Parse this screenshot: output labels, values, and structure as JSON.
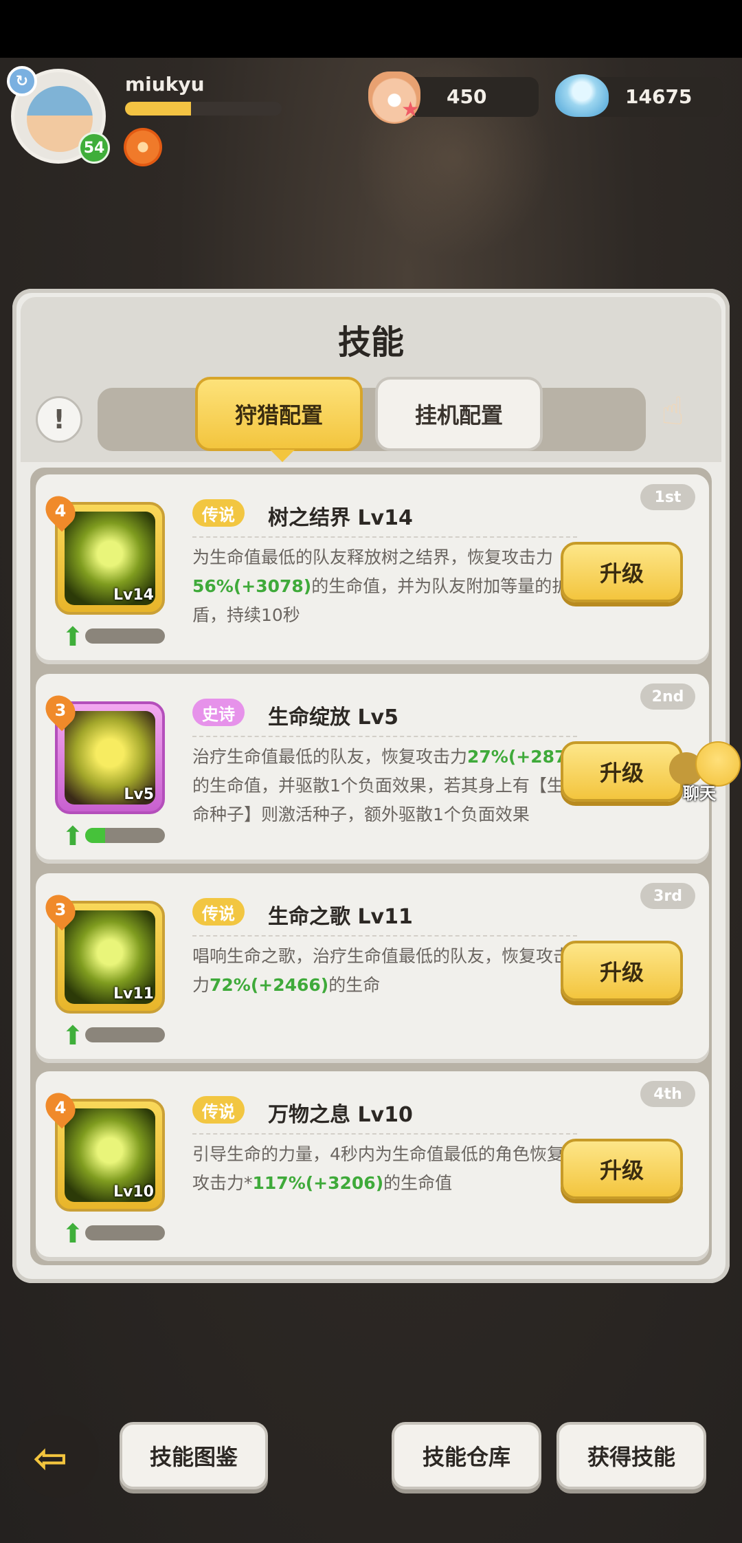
{
  "player": {
    "username": "miukyu",
    "level": "54",
    "xp_fraction": 0.42
  },
  "currencies": [
    {
      "icon": "pearl-shell-icon",
      "value": "450"
    },
    {
      "icon": "blue-shell-icon",
      "value": "14675"
    }
  ],
  "panel": {
    "title": "技能",
    "tabs": [
      {
        "label": "狩猎配置",
        "active": true
      },
      {
        "label": "挂机配置",
        "active": false
      }
    ],
    "info_button": "!"
  },
  "skills": [
    {
      "rank": "1st",
      "stars": "4",
      "rarity": "传说",
      "name": "树之结界 Lv14",
      "icon_level": "Lv14",
      "desc_parts": [
        "为生命值最低的队友释放树之结界，恢复攻击力",
        "56%(+3078)",
        "的生命值，并为队友附加等量的护盾，持续10秒"
      ],
      "progress": 0.0,
      "button": "升级"
    },
    {
      "rank": "2nd",
      "stars": "3",
      "rarity": "史诗",
      "name": "生命绽放 Lv5",
      "icon_level": "Lv5",
      "desc_parts": [
        "治疗生命值最低的队友，恢复攻击力",
        "27%(+287)",
        "的生命值，并驱散1个负面效果，若其身上有【生命种子】则激活种子，额外驱散1个负面效果"
      ],
      "progress": 0.25,
      "button": "升级"
    },
    {
      "rank": "3rd",
      "stars": "3",
      "rarity": "传说",
      "name": "生命之歌 Lv11",
      "icon_level": "Lv11",
      "desc_parts": [
        "唱响生命之歌，治疗生命值最低的队友，恢复攻击力",
        "72%(+2466)",
        "的生命"
      ],
      "progress": 0.0,
      "button": "升级"
    },
    {
      "rank": "4th",
      "stars": "4",
      "rarity": "传说",
      "name": "万物之息 Lv10",
      "icon_level": "Lv10",
      "desc_parts": [
        "引导生命的力量，4秒内为生命值最低的角色恢复攻击力*",
        "117%(+3206)",
        "的生命值"
      ],
      "progress": 0.0,
      "button": "升级"
    }
  ],
  "chat": {
    "label": "聊天"
  },
  "bottom": {
    "back_icon": "back-arrow-icon",
    "buttons": [
      "技能图鉴",
      "技能仓库",
      "获得技能"
    ]
  }
}
